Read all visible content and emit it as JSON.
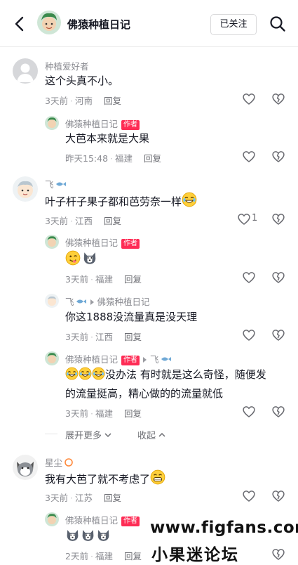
{
  "header": {
    "title": "佛猿种植日记",
    "follow_label": "已关注"
  },
  "comments": [
    {
      "user": "种植爱好者",
      "text": "这个头真不小。",
      "time": "3天前",
      "location": "河南",
      "reply_label": "回复",
      "replies": [
        {
          "user": "佛猿种植日记",
          "badge": "作者",
          "text": "大芭本来就是大果",
          "time": "昨天15:48",
          "location": "福建",
          "reply_label": "回复"
        }
      ]
    },
    {
      "user": "飞",
      "text": "叶子杆子果子都和芭劳奈一样",
      "time": "3天前",
      "location": "江西",
      "reply_label": "回复",
      "like_count": "1",
      "replies": [
        {
          "user": "佛猿种植日记",
          "badge": "作者",
          "text": "",
          "time": "3天前",
          "location": "福建",
          "reply_label": "回复"
        },
        {
          "user": "飞",
          "reply_to": "佛猿种植日记",
          "text": "你这1888没流量真是没天理",
          "time": "3天前",
          "location": "江西",
          "reply_label": "回复"
        },
        {
          "user": "佛猿种植日记",
          "badge": "作者",
          "reply_to": "飞",
          "text_line1": "没办法 有时就是这么奇怪，随便发",
          "text_line2": "的流量挺高，精心做的的流量就低",
          "time": "3天前",
          "location": "福建",
          "reply_label": "回复"
        }
      ],
      "expand_label": "展开更多",
      "collapse_label": "收起"
    },
    {
      "user": "星尘",
      "text": "我有大芭了就不考虑了",
      "time": "3天前",
      "location": "江苏",
      "reply_label": "回复",
      "replies": [
        {
          "user": "佛猿种植日记",
          "badge": "作者",
          "text": "",
          "time": "2天前",
          "location": "福建",
          "reply_label": "回复"
        }
      ]
    }
  ],
  "watermark": {
    "line1": "www.figfans.com",
    "line2": "小果迷论坛"
  },
  "colors": {
    "badge": "#fe2c55",
    "meta": "#8a8b91",
    "text": "#161823"
  }
}
